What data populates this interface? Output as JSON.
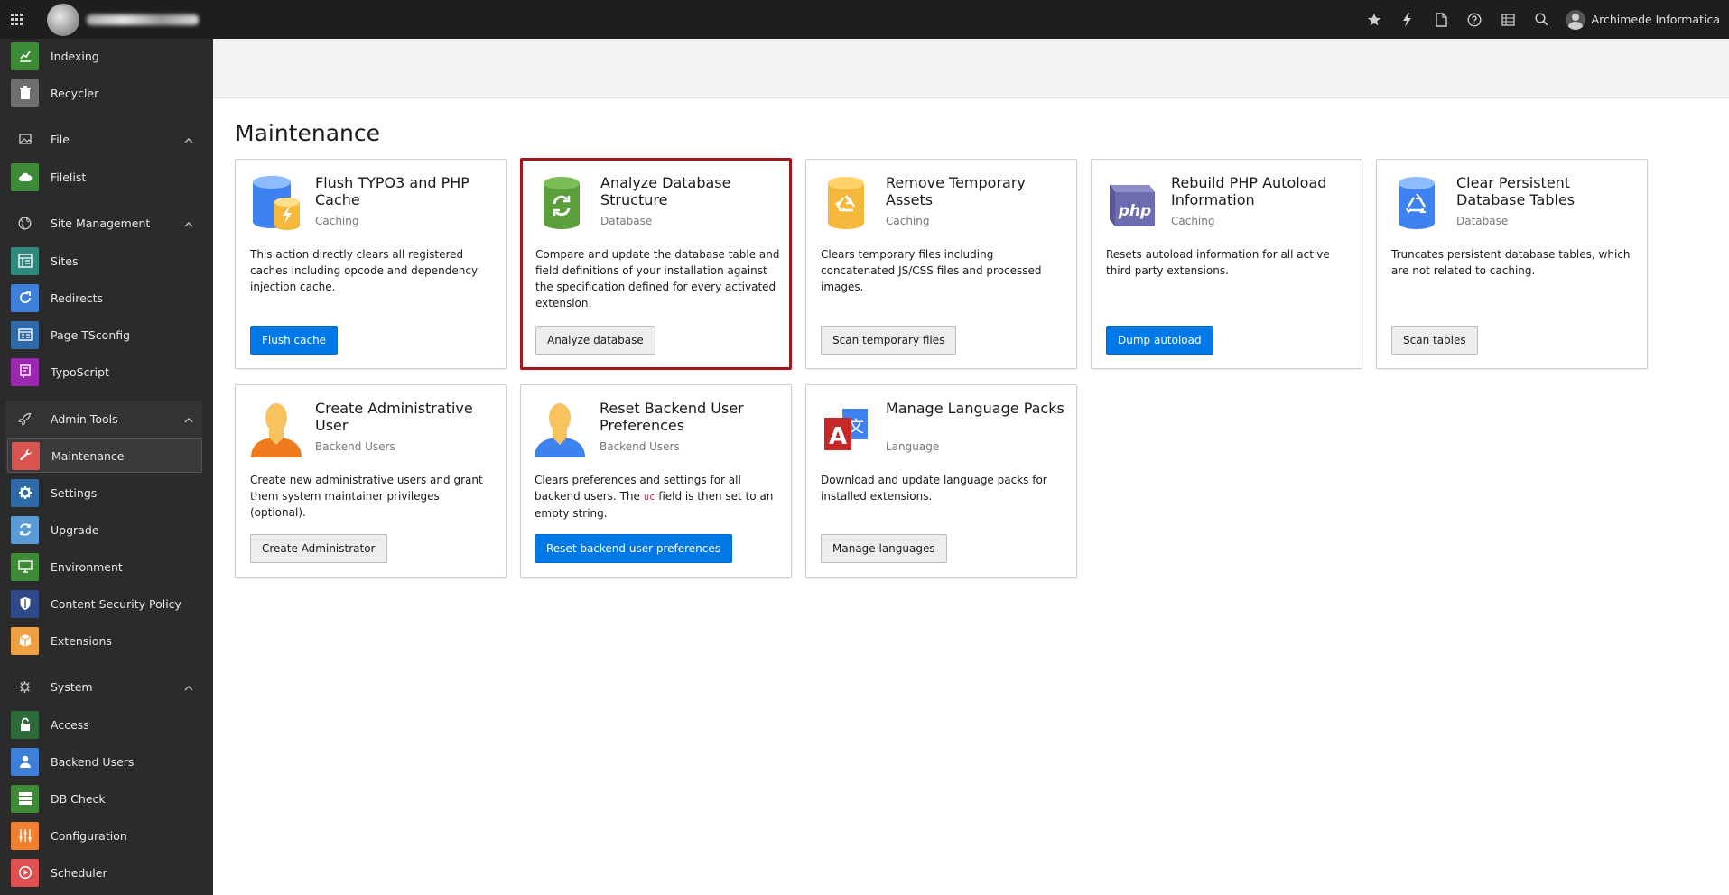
{
  "topbar": {
    "user_name": "Archimede Informatica"
  },
  "sidebar": {
    "items": [
      {
        "label": "Indexing",
        "icon": "indexing-icon",
        "color": "#3d8b37"
      },
      {
        "label": "Recycler",
        "icon": "trash-icon",
        "color": "#6f6f6f"
      },
      {
        "label": "File",
        "type": "group"
      },
      {
        "label": "Filelist",
        "icon": "filelist-icon",
        "color": "#3d8b37"
      },
      {
        "label": "Site Management",
        "type": "group"
      },
      {
        "label": "Sites",
        "icon": "sites-icon",
        "color": "#2e8a7c"
      },
      {
        "label": "Redirects",
        "icon": "redirect-icon",
        "color": "#3d7fd9"
      },
      {
        "label": "Page TSconfig",
        "icon": "tsconfig-icon",
        "color": "#2e6aa8"
      },
      {
        "label": "TypoScript",
        "icon": "typoscript-icon",
        "color": "#9c27b0"
      },
      {
        "label": "Admin Tools",
        "type": "group"
      },
      {
        "label": "Maintenance",
        "icon": "wrench-icon",
        "color": "#d9534f"
      },
      {
        "label": "Settings",
        "icon": "gear-icon",
        "color": "#2e6aa8"
      },
      {
        "label": "Upgrade",
        "icon": "upgrade-icon",
        "color": "#5b9bd5"
      },
      {
        "label": "Environment",
        "icon": "environment-icon",
        "color": "#3d8b37"
      },
      {
        "label": "Content Security Policy",
        "icon": "shield-icon",
        "color": "#2e4a8a"
      },
      {
        "label": "Extensions",
        "icon": "extensions-icon",
        "color": "#f0a040"
      },
      {
        "label": "System",
        "type": "group"
      },
      {
        "label": "Access",
        "icon": "lock-icon",
        "color": "#2e6b3a"
      },
      {
        "label": "Backend Users",
        "icon": "user-icon",
        "color": "#3d7fd9"
      },
      {
        "label": "DB Check",
        "icon": "database-icon",
        "color": "#3d8b37"
      },
      {
        "label": "Configuration",
        "icon": "configuration-icon",
        "color": "#f08030"
      },
      {
        "label": "Scheduler",
        "icon": "scheduler-icon",
        "color": "#e05050"
      }
    ]
  },
  "main": {
    "title": "Maintenance",
    "cards": [
      {
        "title": "Flush TYPO3 and PHP Cache",
        "subtitle": "Caching",
        "description": "This action directly clears all registered caches including opcode and dependency injection cache.",
        "button": "Flush cache"
      },
      {
        "title": "Analyze Database Structure",
        "subtitle": "Database",
        "description": "Compare and update the database table and field definitions of your installation against the specification defined for every activated extension.",
        "button": "Analyze database"
      },
      {
        "title": "Remove Temporary Assets",
        "subtitle": "Caching",
        "description": "Clears temporary files including concatenated JS/CSS files and processed images.",
        "button": "Scan temporary files"
      },
      {
        "title": "Rebuild PHP Autoload Information",
        "subtitle": "Caching",
        "description": "Resets autoload information for all active third party extensions.",
        "button": "Dump autoload"
      },
      {
        "title": "Clear Persistent Database Tables",
        "subtitle": "Database",
        "description": "Truncates persistent database tables, which are not related to caching.",
        "button": "Scan tables"
      },
      {
        "title": "Create Administrative User",
        "subtitle": "Backend Users",
        "description": "Create new administrative users and grant them system maintainer privileges (optional).",
        "button": "Create Administrator"
      },
      {
        "title": "Reset Backend User Preferences",
        "subtitle": "Backend Users",
        "description_before": "Clears preferences and settings for all backend users. The",
        "description_code": "uc",
        "description_after": "field is then set to an empty string.",
        "button": "Reset backend user preferences"
      },
      {
        "title": "Manage Language Packs",
        "subtitle": "Language",
        "description": "Download and update language packs for installed extensions.",
        "button": "Manage languages"
      }
    ]
  }
}
